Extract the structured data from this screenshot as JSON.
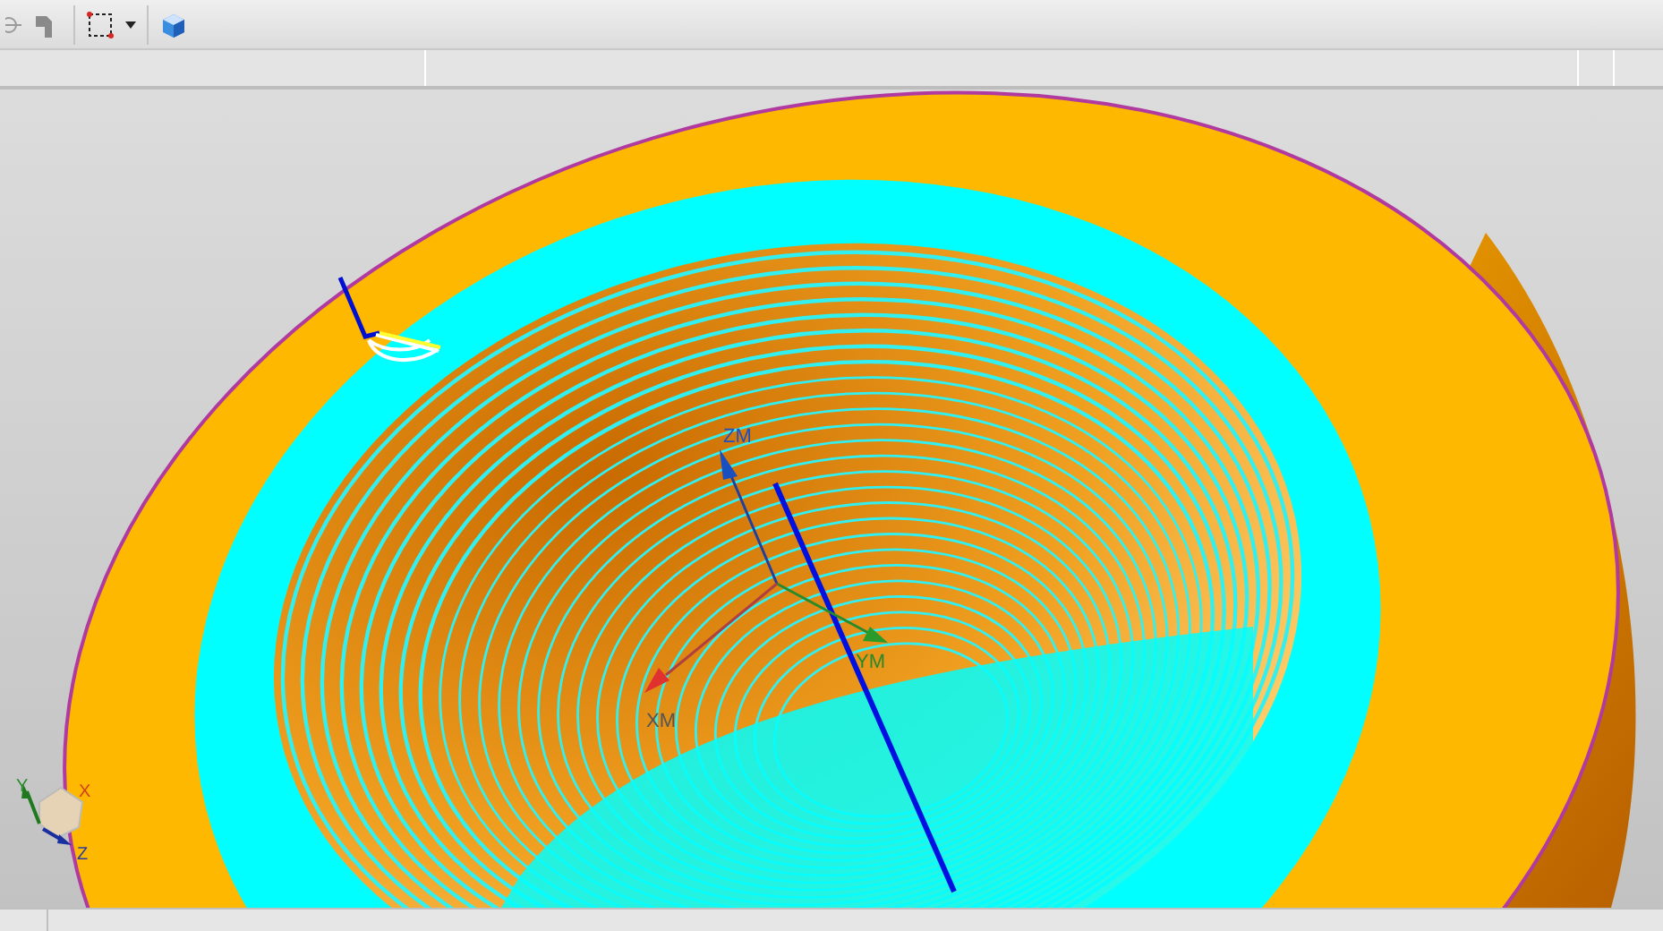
{
  "toolbar": {
    "buttons": [
      {
        "kind": "snap"
      },
      {
        "kind": "part"
      },
      {
        "kind": "select-box"
      },
      {
        "kind": "dropdown"
      },
      {
        "kind": "view-cube"
      }
    ]
  },
  "viewport": {
    "csys_labels": [
      "ZM",
      "YM",
      "XM"
    ],
    "triad_labels": [
      "Y",
      "X",
      "Z"
    ]
  }
}
